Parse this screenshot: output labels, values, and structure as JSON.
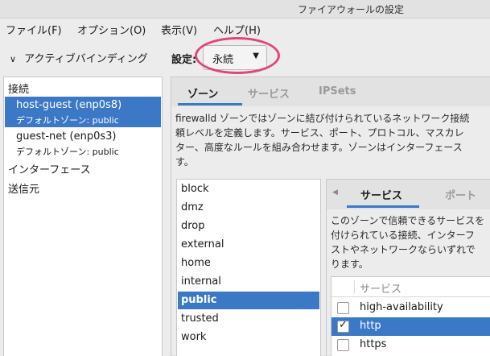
{
  "window": {
    "title": "ファイアウォールの設定"
  },
  "menubar": [
    {
      "label": "ファイル(F)"
    },
    {
      "label": "オプション(O)"
    },
    {
      "label": "表示(V)"
    },
    {
      "label": "ヘルプ(H)"
    }
  ],
  "left": {
    "active_bindings_label": "アクティブバインディング",
    "connections_heading": "接続",
    "connections": [
      {
        "name": "host-guest (enp0s8)",
        "zone": "デフォルトゾーン: public",
        "selected": true
      },
      {
        "name": "guest-net (enp0s3)",
        "zone": "デフォルトゾーン: public",
        "selected": false
      }
    ],
    "interfaces_heading": "インターフェース",
    "sources_heading": "送信元"
  },
  "config": {
    "label": "設定:",
    "value": "永続"
  },
  "tabs": [
    {
      "label": "ゾーン",
      "active": true
    },
    {
      "label": "サービス",
      "active": false
    },
    {
      "label": "IPSets",
      "active": false
    }
  ],
  "zones_description": [
    "firewalld ゾーンではゾーンに結び付けられているネットワーク接続",
    "頼レベルを定義します。サービス、ポート、プロトコル、マスカレ",
    "ター、高度なルールを組み合わせます。ゾーンはインターフェース",
    "す。"
  ],
  "zones": [
    {
      "name": "block",
      "selected": false
    },
    {
      "name": "dmz",
      "selected": false
    },
    {
      "name": "drop",
      "selected": false
    },
    {
      "name": "external",
      "selected": false
    },
    {
      "name": "home",
      "selected": false
    },
    {
      "name": "internal",
      "selected": false
    },
    {
      "name": "public",
      "selected": true
    },
    {
      "name": "trusted",
      "selected": false
    },
    {
      "name": "work",
      "selected": false
    }
  ],
  "subtabs": [
    {
      "label": "サービス",
      "active": true
    },
    {
      "label": "ポート",
      "active": false
    }
  ],
  "services_description": [
    "このゾーンで信頼できるサービスを",
    "付けられている接続、インターフ",
    "ストやネットワークならいずれで",
    "ります。"
  ],
  "services_table": {
    "header": "サービス",
    "rows": [
      {
        "name": "high-availability",
        "checked": false,
        "selected": false
      },
      {
        "name": "http",
        "checked": true,
        "selected": true
      },
      {
        "name": "https",
        "checked": false,
        "selected": false
      }
    ]
  },
  "colors": {
    "accent": "#3b78c6",
    "highlight_ring": "#e0457b"
  }
}
